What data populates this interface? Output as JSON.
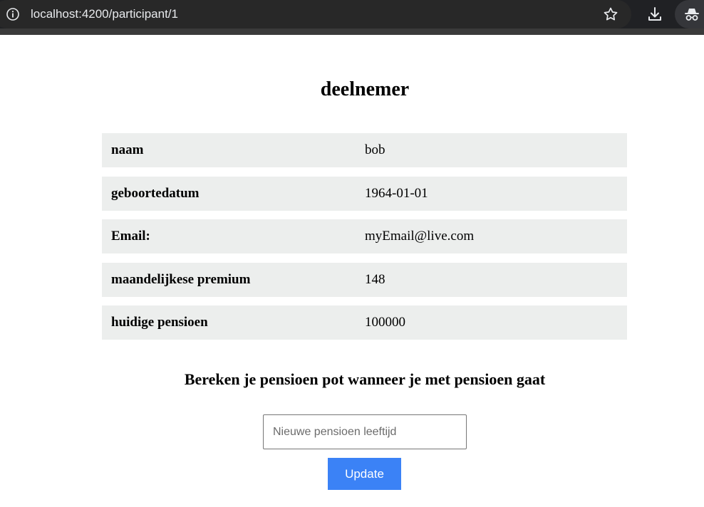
{
  "browser": {
    "url": "localhost:4200/participant/1",
    "icons": [
      "info-icon",
      "star-icon",
      "download-icon",
      "incognito-icon"
    ]
  },
  "page": {
    "title": "deelnemer",
    "details": [
      {
        "label": "naam",
        "value": "bob"
      },
      {
        "label": "geboortedatum",
        "value": "1964-01-01"
      },
      {
        "label": "Email:",
        "value": "myEmail@live.com"
      },
      {
        "label": "maandelijkese premium",
        "value": "148"
      },
      {
        "label": "huidige pensioen",
        "value": "100000"
      }
    ],
    "calc_heading": "Bereken je pensioen pot wanneer je met pensioen gaat",
    "age_input": {
      "placeholder": "Nieuwe pensioen leeftijd",
      "value": ""
    },
    "update_label": "Update"
  },
  "colors": {
    "row_background": "#eceeed",
    "button_background": "#3b82f6",
    "chrome_background": "#202124"
  }
}
